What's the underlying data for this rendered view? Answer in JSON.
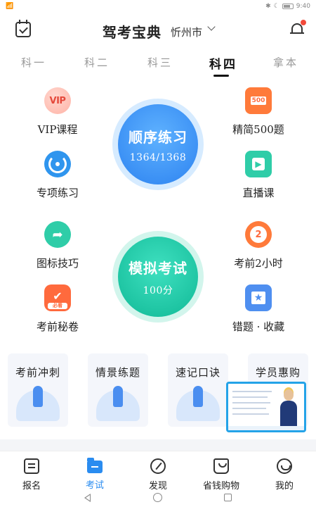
{
  "status": {
    "time": "9:40"
  },
  "header": {
    "title": "驾考宝典",
    "city": "忻州市"
  },
  "tabs": [
    {
      "label": "科一"
    },
    {
      "label": "科二"
    },
    {
      "label": "科三"
    },
    {
      "label": "科四"
    },
    {
      "label": "拿本"
    }
  ],
  "left_items": [
    {
      "label": "VIP课程",
      "icon_text": "VIP"
    },
    {
      "label": "专项练习"
    },
    {
      "label": "图标技巧"
    },
    {
      "label": "考前秘卷",
      "icon_text": "必看"
    }
  ],
  "right_items": [
    {
      "label": "精简500题",
      "icon_text": "500"
    },
    {
      "label": "直播课"
    },
    {
      "label": "考前2小时",
      "icon_text": "2"
    },
    {
      "label": "错题 · 收藏"
    }
  ],
  "sequential": {
    "title": "顺序练习",
    "progress": "1364/1368"
  },
  "mock": {
    "title": "模拟考试",
    "score": "100分"
  },
  "cards": [
    {
      "label": "考前冲刺"
    },
    {
      "label": "情景练题"
    },
    {
      "label": "速记口诀"
    },
    {
      "label": "学员惠购"
    }
  ],
  "bottom_nav": [
    {
      "label": "报名"
    },
    {
      "label": "考试"
    },
    {
      "label": "发现"
    },
    {
      "label": "省钱购物"
    },
    {
      "label": "我的"
    }
  ],
  "colors": {
    "accent": "#2a8cf0",
    "green": "#10b996",
    "notify": "#f24a3a"
  }
}
